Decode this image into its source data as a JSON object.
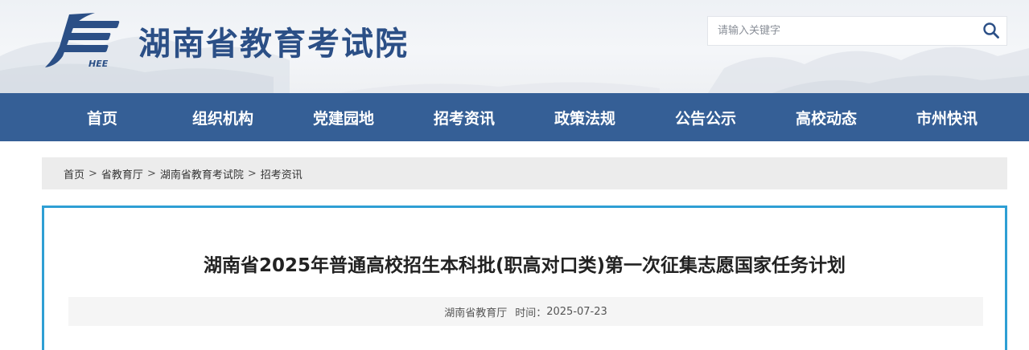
{
  "header": {
    "site_title": "湖南省教育考试院",
    "logo_text": "HEE",
    "search_placeholder": "请输入关键字"
  },
  "nav": {
    "items": [
      {
        "label": "首页"
      },
      {
        "label": "组织机构"
      },
      {
        "label": "党建园地"
      },
      {
        "label": "招考资讯"
      },
      {
        "label": "政策法规"
      },
      {
        "label": "公告公示"
      },
      {
        "label": "高校动态"
      },
      {
        "label": "市州快讯"
      }
    ]
  },
  "breadcrumb": {
    "items": [
      "首页",
      "省教育厅",
      "湖南省教育考试院",
      "招考资讯"
    ],
    "separator": ">"
  },
  "article": {
    "title": "湖南省2025年普通高校招生本科批(职高对口类)第一次征集志愿国家任务计划",
    "source": "湖南省教育厅",
    "time_label": "时间：",
    "date": "2025-07-23"
  },
  "colors": {
    "nav_bg": "#355f96",
    "title_blue": "#2b4f86",
    "article_border": "#2e9fd4",
    "breadcrumb_bg": "#ececec"
  },
  "icons": {
    "logo": "hee-logo",
    "search": "search-icon"
  }
}
